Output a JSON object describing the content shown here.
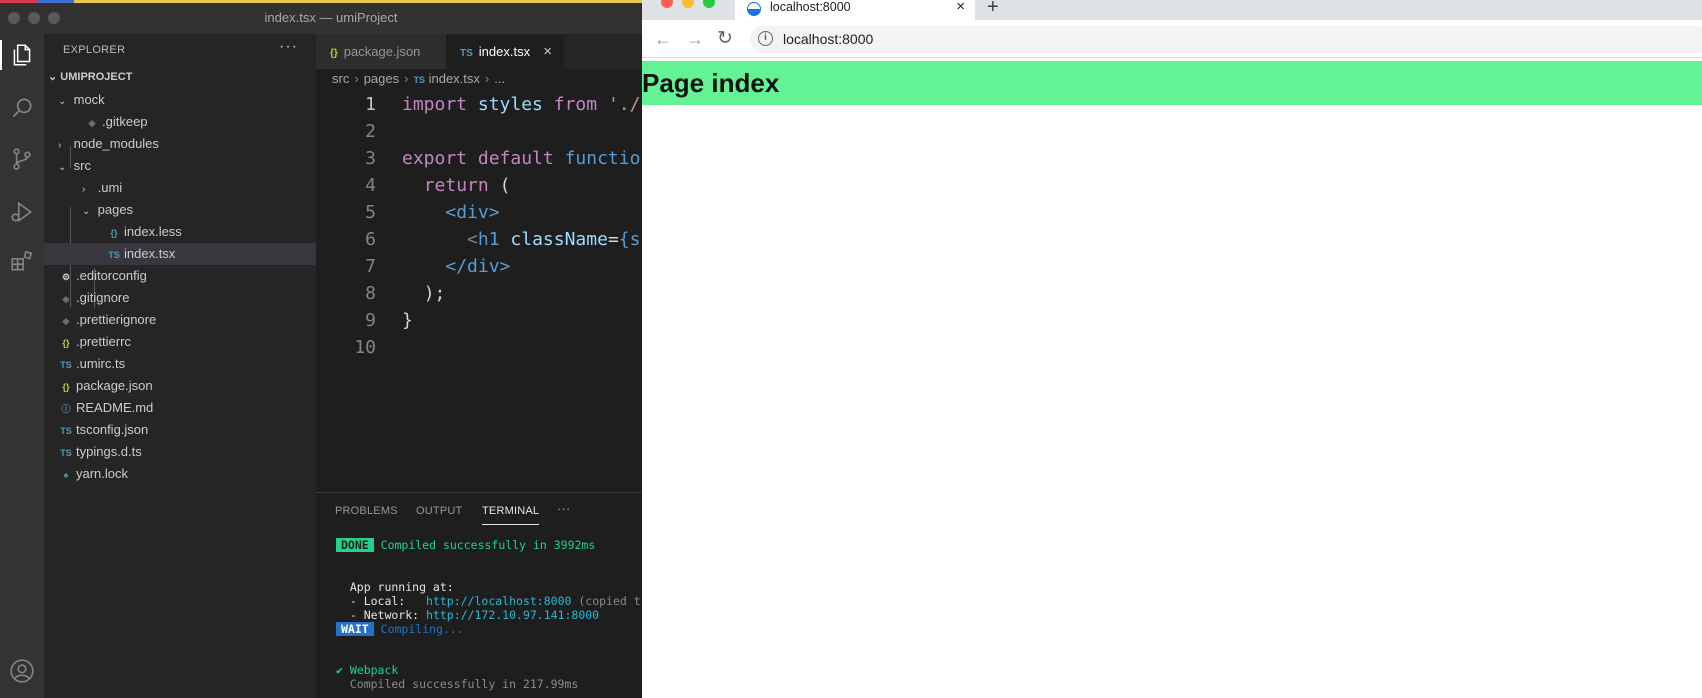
{
  "vscode": {
    "window_title": "index.tsx — umiProject",
    "explorer_header": "EXPLORER",
    "explorer_more": "···",
    "root_folder": "UMIPROJECT",
    "tree": [
      {
        "label": "mock",
        "type": "folder-open",
        "icon": "chevron-down-icon"
      },
      {
        "label": ".gitkeep",
        "type": "file",
        "icon": "gitkeep-file-icon"
      },
      {
        "label": "node_modules",
        "type": "folder",
        "icon": "chevron-right-icon"
      },
      {
        "label": "src",
        "type": "folder-open",
        "icon": "chevron-down-icon"
      },
      {
        "label": ".umi",
        "type": "folder",
        "icon": "chevron-right-icon"
      },
      {
        "label": "pages",
        "type": "folder-open",
        "icon": "chevron-down-icon"
      },
      {
        "label": "index.less",
        "type": "file",
        "icon": "braces-file-icon",
        "badge": "{}"
      },
      {
        "label": "index.tsx",
        "type": "file",
        "icon": "ts-file-icon",
        "badge": "TS"
      },
      {
        "label": ".editorconfig",
        "type": "file",
        "icon": "gear-file-icon",
        "badge": "⚙"
      },
      {
        "label": ".gitignore",
        "type": "file",
        "icon": "git-file-icon",
        "badge": "◆"
      },
      {
        "label": ".prettierignore",
        "type": "file",
        "icon": "prettier-file-icon",
        "badge": "◆"
      },
      {
        "label": ".prettierrc",
        "type": "file",
        "icon": "json-file-icon",
        "badge": "{}"
      },
      {
        "label": ".umirc.ts",
        "type": "file",
        "icon": "ts-file-icon",
        "badge": "TS"
      },
      {
        "label": "package.json",
        "type": "file",
        "icon": "json-file-icon",
        "badge": "{}"
      },
      {
        "label": "README.md",
        "type": "file",
        "icon": "info-file-icon",
        "badge": "ⓘ"
      },
      {
        "label": "tsconfig.json",
        "type": "file",
        "icon": "tsconfig-file-icon",
        "badge": "TS"
      },
      {
        "label": "typings.d.ts",
        "type": "file",
        "icon": "ts-file-icon",
        "badge": "TS"
      },
      {
        "label": "yarn.lock",
        "type": "file",
        "icon": "yarn-file-icon",
        "badge": "🧶"
      }
    ],
    "tabs": [
      {
        "label": "package.json",
        "badge": "{}",
        "active": false
      },
      {
        "label": "index.tsx",
        "badge": "TS",
        "active": true,
        "close": "×"
      }
    ],
    "breadcrumb": {
      "part1": "src",
      "part2": "pages",
      "badge": "TS",
      "part3": "index.tsx",
      "part4": "..."
    },
    "code_lines": [
      {
        "n": "1"
      },
      {
        "n": "2"
      },
      {
        "n": "3"
      },
      {
        "n": "4"
      },
      {
        "n": "5"
      },
      {
        "n": "6"
      },
      {
        "n": "7"
      },
      {
        "n": "8"
      },
      {
        "n": "9"
      },
      {
        "n": "10"
      }
    ],
    "code": {
      "l1_import": "import",
      "l1_styles": "styles",
      "l1_from": "from",
      "l1_str": "'./",
      "l3_export": "export",
      "l3_default": "default",
      "l3_function": "functio",
      "l4_return": "return",
      "l4_paren": "(",
      "l5_div": "<div>",
      "l6_lt": "<",
      "l6_h1": "h1",
      "l6_attr": "className",
      "l6_eq": "=",
      "l6_brace": "{s",
      "l7_div": "</div>",
      "l8_end": ");",
      "l9_end": "}"
    },
    "panel": {
      "tabs": [
        "PROBLEMS",
        "OUTPUT",
        "TERMINAL"
      ],
      "more": "···",
      "terminal": {
        "done_badge": "DONE",
        "done_text": "Compiled successfully in 3992ms",
        "app_running": "  App running at:",
        "local_label": "  - Local:   ",
        "local_url": "http://localhost:8000",
        "local_note": " (copied t",
        "network_label": "  - Network: ",
        "network_url": "http://172.10.97.141:8000",
        "wait_badge": "WAIT",
        "wait_text": "Compiling...",
        "webpack_line": "✔ Webpack",
        "webpack_compiled": "  Compiled successfully in 217.99ms"
      }
    }
  },
  "browser": {
    "tab_title": "localhost:8000",
    "tab_close": "×",
    "new_tab": "+",
    "back": "←",
    "forward": "→",
    "reload": "↻",
    "info_icon": "i",
    "url": "localhost:8000",
    "page_heading": "Page index",
    "heading_bg": "#63f294"
  }
}
